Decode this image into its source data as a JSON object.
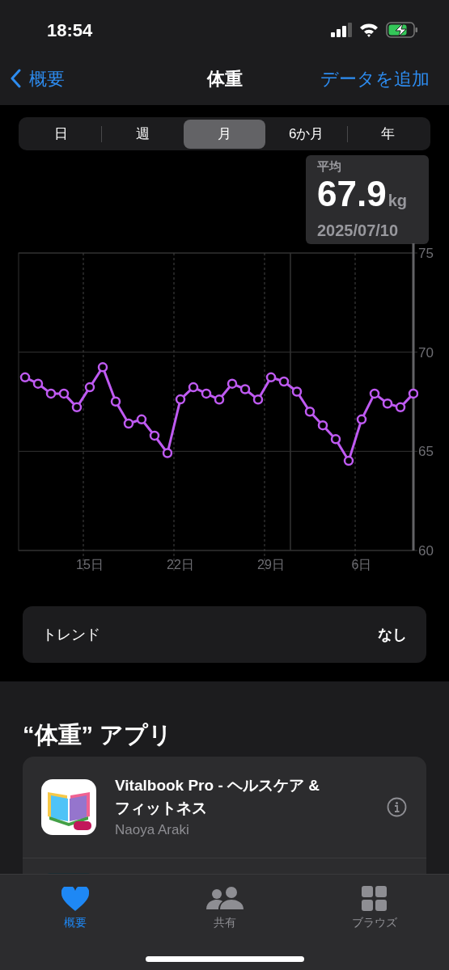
{
  "status_bar": {
    "time": "18:54"
  },
  "nav": {
    "back_label": "概要",
    "title": "体重",
    "action": "データを追加"
  },
  "range_tabs": [
    {
      "label": "日",
      "selected": false
    },
    {
      "label": "週",
      "selected": false
    },
    {
      "label": "月",
      "selected": true
    },
    {
      "label": "6か月",
      "selected": false
    },
    {
      "label": "年",
      "selected": false
    }
  ],
  "summary": {
    "label": "平均",
    "value": "67.9",
    "unit": "kg",
    "date": "2025/07/10"
  },
  "chart": {
    "chart_data": {
      "type": "line",
      "categories": [
        null,
        null,
        null,
        null,
        null,
        "15日",
        null,
        null,
        null,
        null,
        null,
        null,
        "22日",
        null,
        null,
        null,
        null,
        null,
        null,
        "29日",
        null,
        null,
        null,
        null,
        null,
        null,
        "6日",
        null,
        null,
        null,
        null
      ],
      "series": [
        {
          "color": "#bf5af2",
          "marker": "o",
          "values": [
            68.73,
            68.41,
            67.91,
            67.91,
            67.22,
            68.23,
            69.24,
            67.51,
            66.4,
            66.61,
            65.79,
            64.91,
            67.62,
            68.23,
            67.91,
            67.61,
            68.41,
            68.13,
            67.61,
            68.73,
            68.52,
            68.01,
            67.0,
            66.31,
            65.61,
            64.52,
            66.61,
            67.91,
            67.41,
            67.22,
            67.91
          ]
        }
      ],
      "ylim": [
        60,
        75
      ],
      "yticks": [
        60,
        65,
        70,
        75
      ]
    }
  },
  "trend": {
    "label": "トレンド",
    "value": "なし"
  },
  "apps": {
    "heading": "“体重” アプリ",
    "items": [
      {
        "name": "Vitalbook Pro - ヘルスケア & フィットネス",
        "developer": "Naoya Araki"
      }
    ]
  },
  "tab_bar": [
    {
      "label": "概要",
      "selected": true
    },
    {
      "label": "共有",
      "selected": false
    },
    {
      "label": "ブラウズ",
      "selected": false
    }
  ]
}
